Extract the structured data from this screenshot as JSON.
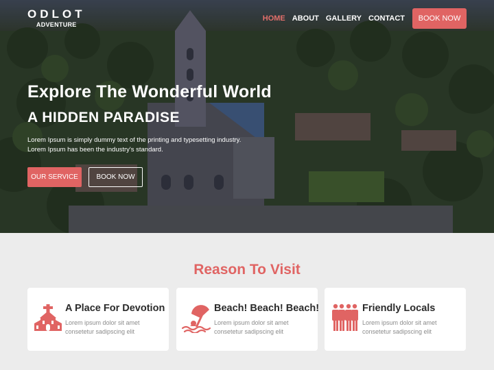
{
  "brand": {
    "name": "ODLOT",
    "tagline": "ADVENTURE"
  },
  "nav": {
    "links": [
      "HOME",
      "ABOUT",
      "GALLERY",
      "CONTACT"
    ],
    "active": "HOME",
    "cta": "BOOK NOW"
  },
  "hero": {
    "title": "Explore The Wonderful World",
    "subtitle": "A HIDDEN PARADISE",
    "description": "Lorem Ipsum is simply dummy text of the printing and typesetting industry. Lorem Ipsum has been the industry's standard.",
    "primary_button": "OUR SERVICE",
    "secondary_button": "BOOK NOW"
  },
  "reasons": {
    "title": "Reason To Visit",
    "cards": [
      {
        "title": "A Place For Devotion",
        "text": "Lorem ipsum dolor sit amet consetetur sadipscing elit",
        "icon": "church-icon"
      },
      {
        "title": "Beach! Beach! Beach!",
        "text": "Lorem ipsum dolor sit amet consetetur sadipscing elit",
        "icon": "beach-umbrella-icon"
      },
      {
        "title": "Friendly Locals",
        "text": "Lorem ipsum dolor sit amet consetetur sadipscing elit",
        "icon": "people-icon"
      }
    ]
  },
  "colors": {
    "accent": "#e06463",
    "active_nav": "#e36f6b",
    "section_bg": "#ececec",
    "card_bg": "#ffffff"
  }
}
